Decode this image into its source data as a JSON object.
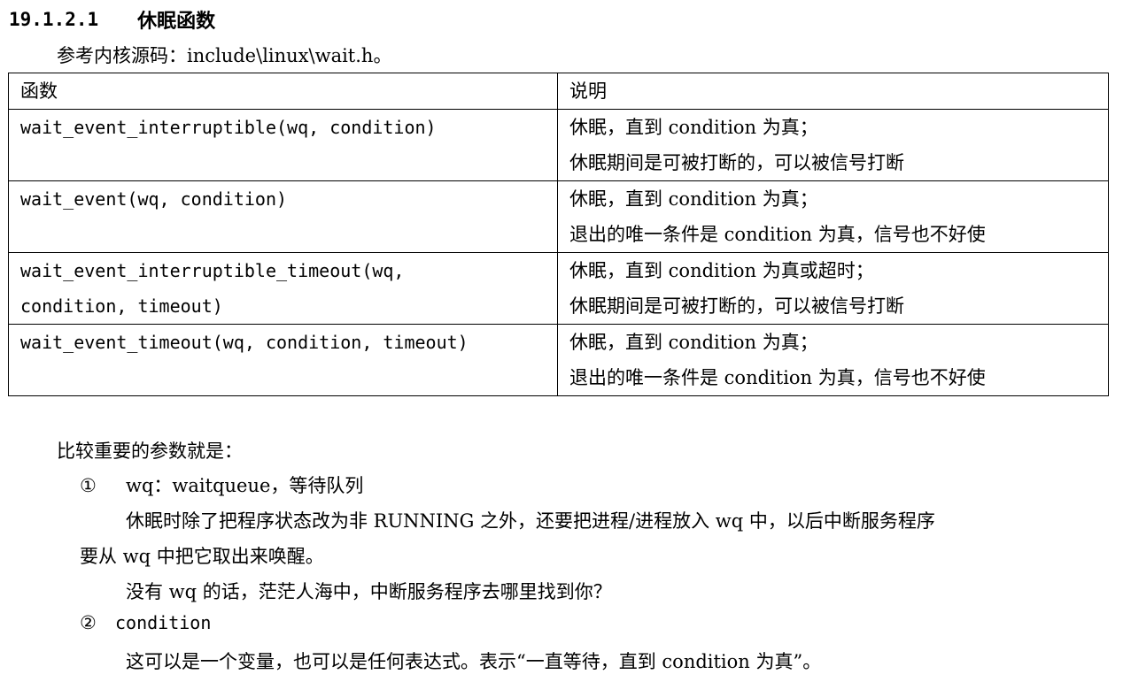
{
  "section": {
    "number": "19.1.2.1",
    "title": "休眠函数",
    "reference": "参考内核源码：include\\linux\\wait.h。"
  },
  "table": {
    "headers": [
      "函数",
      "说明"
    ],
    "rows": [
      {
        "func": [
          "wait_event_interruptible(wq, condition)"
        ],
        "desc": [
          "休眠，直到 condition 为真；",
          "休眠期间是可被打断的，可以被信号打断"
        ]
      },
      {
        "func": [
          "wait_event(wq, condition)"
        ],
        "desc": [
          "休眠，直到 condition 为真；",
          "退出的唯一条件是 condition 为真，信号也不好使"
        ]
      },
      {
        "func": [
          "wait_event_interruptible_timeout(wq,",
          "condition, timeout)"
        ],
        "desc": [
          "休眠，直到 condition 为真或超时；",
          "休眠期间是可被打断的，可以被信号打断"
        ]
      },
      {
        "func": [
          "wait_event_timeout(wq, condition, timeout)"
        ],
        "desc": [
          "休眠，直到 condition 为真；",
          "退出的唯一条件是 condition 为真，信号也不好使"
        ]
      }
    ]
  },
  "body": {
    "intro": "比较重要的参数就是：",
    "item1_marker": "①",
    "item1_title": "wq：waitqueue，等待队列",
    "item1_p1_line1": "休眠时除了把程序状态改为非 RUNNING 之外，还要把进程/进程放入 wq 中，以后中断服务程序",
    "item1_p1_line2": "要从 wq 中把它取出来唤醒。",
    "item1_p2": "没有 wq 的话，茫茫人海中，中断服务程序去哪里找到你？",
    "item2_marker": "②",
    "item2_title": "condition",
    "item2_p1": "这可以是一个变量，也可以是任何表达式。表示“一直等待，直到 condition 为真”。"
  }
}
